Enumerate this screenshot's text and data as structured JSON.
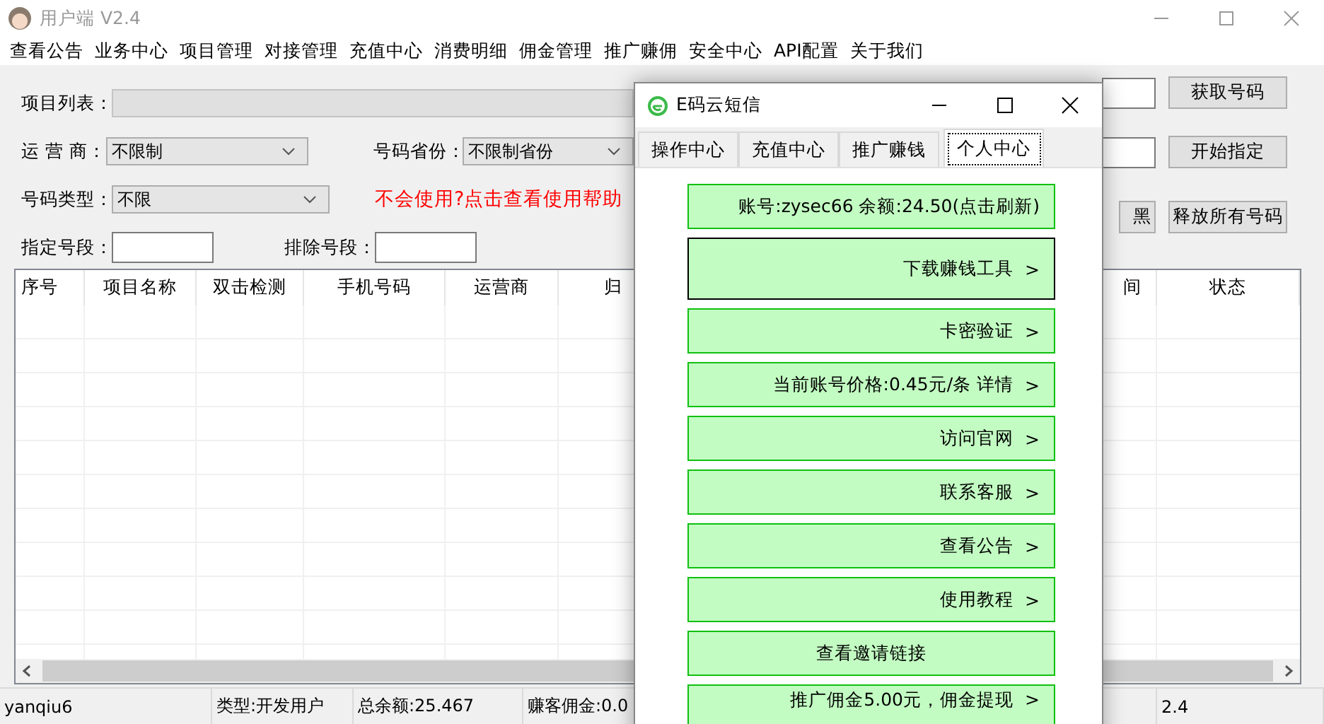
{
  "main_window": {
    "title": "用户端 V2.4",
    "menu": [
      "查看公告",
      "业务中心",
      "项目管理",
      "对接管理",
      "充值中心",
      "消费明细",
      "佣金管理",
      "推广赚佣",
      "安全中心",
      "API配置",
      "关于我们"
    ],
    "form": {
      "project_list": {
        "label": "项目列表：",
        "disabled": true
      },
      "carrier": {
        "label": "运 营 商：",
        "value": "不限制"
      },
      "province": {
        "label": "号码省份：",
        "value": "不限制省份"
      },
      "number_type": {
        "label": "号码类型：",
        "value": "不限"
      },
      "help_link": "不会使用?点击查看使用帮助",
      "prefix": {
        "label": "指定号段："
      },
      "exclude": {
        "label": "排除号段："
      }
    },
    "buttons": [
      "获取号码",
      "开始指定",
      "黑",
      "释放所有号码"
    ],
    "table": {
      "columns": [
        "序号",
        "项目名称",
        "双击检测",
        "手机号码",
        "运营商",
        "归",
        "间",
        "状态"
      ]
    },
    "status_bar": [
      "yanqiu6",
      "类型:开发用户",
      "总余额:25.467",
      "赚客佣金:0.0",
      "2.4"
    ]
  },
  "dialog": {
    "title": "E码云短信",
    "tabs": [
      {
        "label": "操作中心",
        "selected": false
      },
      {
        "label": "充值中心",
        "selected": false
      },
      {
        "label": "推广赚钱",
        "selected": false
      },
      {
        "label": "个人中心",
        "selected": true
      }
    ],
    "items": [
      {
        "label": "账号:zysec66 余额:24.50(点击刷新)",
        "kind": "info",
        "focused": false
      },
      {
        "label": "下载赚钱工具",
        "arrow": ">",
        "kind": "link",
        "focused": true
      },
      {
        "label": "卡密验证",
        "arrow": ">",
        "kind": "link",
        "focused": false
      },
      {
        "label": "当前账号价格:0.45元/条 详情",
        "arrow": ">",
        "kind": "link",
        "focused": false
      },
      {
        "label": "访问官网",
        "arrow": ">",
        "kind": "link",
        "focused": false
      },
      {
        "label": "联系客服",
        "arrow": ">",
        "kind": "link",
        "focused": false
      },
      {
        "label": "查看公告",
        "arrow": ">",
        "kind": "link",
        "focused": false
      },
      {
        "label": "使用教程",
        "arrow": ">",
        "kind": "link",
        "focused": false
      },
      {
        "label": "查看邀请链接",
        "kind": "center",
        "focused": false
      },
      {
        "label": "推广佣金5.00元，佣金提现",
        "arrow": ">",
        "kind": "link",
        "focused": false
      }
    ]
  }
}
